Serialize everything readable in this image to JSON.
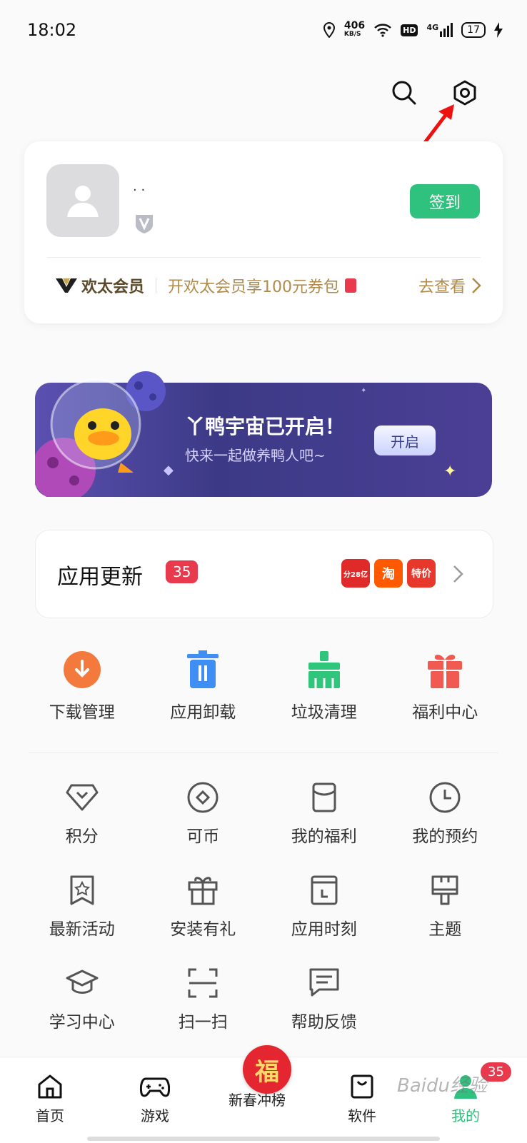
{
  "status": {
    "time": "18:02",
    "net_speed": "406",
    "net_unit": "KB/S",
    "hd": "HD",
    "signal": "4G",
    "battery": "17"
  },
  "profile": {
    "username": "· ·",
    "sign_label": "签到"
  },
  "vip": {
    "brand": "欢太会员",
    "promo": "开欢太会员享100元券包",
    "go_label": "去查看"
  },
  "banner": {
    "title": "丫鸭宇宙已开启！",
    "subtitle": "快来一起做养鸭人吧~",
    "button": "开启"
  },
  "update": {
    "title": "应用更新",
    "count": "35",
    "apps": [
      {
        "label": "分28亿",
        "color": "#e02a2a"
      },
      {
        "label": "淘",
        "color": "#ff5a00"
      },
      {
        "label": "特价",
        "color": "#e8382b"
      }
    ]
  },
  "tools": [
    {
      "label": "下载管理",
      "icon": "download-icon",
      "color": "#f37a3c"
    },
    {
      "label": "应用卸载",
      "icon": "trash-icon",
      "color": "#3f8ef3"
    },
    {
      "label": "垃圾清理",
      "icon": "broom-icon",
      "color": "#2fc57a"
    },
    {
      "label": "福利中心",
      "icon": "gift-icon",
      "color": "#f05a50"
    }
  ],
  "menu": [
    {
      "label": "积分",
      "icon": "diamond-icon"
    },
    {
      "label": "可币",
      "icon": "coin-icon"
    },
    {
      "label": "我的福利",
      "icon": "envelope-icon"
    },
    {
      "label": "我的预约",
      "icon": "clock-icon"
    },
    {
      "label": "最新活动",
      "icon": "star-bookmark-icon"
    },
    {
      "label": "安装有礼",
      "icon": "gift-outline-icon"
    },
    {
      "label": "应用时刻",
      "icon": "calendar-icon"
    },
    {
      "label": "主题",
      "icon": "brush-icon"
    },
    {
      "label": "学习中心",
      "icon": "graduation-cap-icon"
    },
    {
      "label": "扫一扫",
      "icon": "scan-icon"
    },
    {
      "label": "帮助反馈",
      "icon": "feedback-icon"
    }
  ],
  "nav": {
    "home": "首页",
    "games": "游戏",
    "festival": "新春冲榜",
    "fu": "福",
    "software": "软件",
    "mine": "我的",
    "mine_badge": "35"
  },
  "watermark": "Baidu经验"
}
